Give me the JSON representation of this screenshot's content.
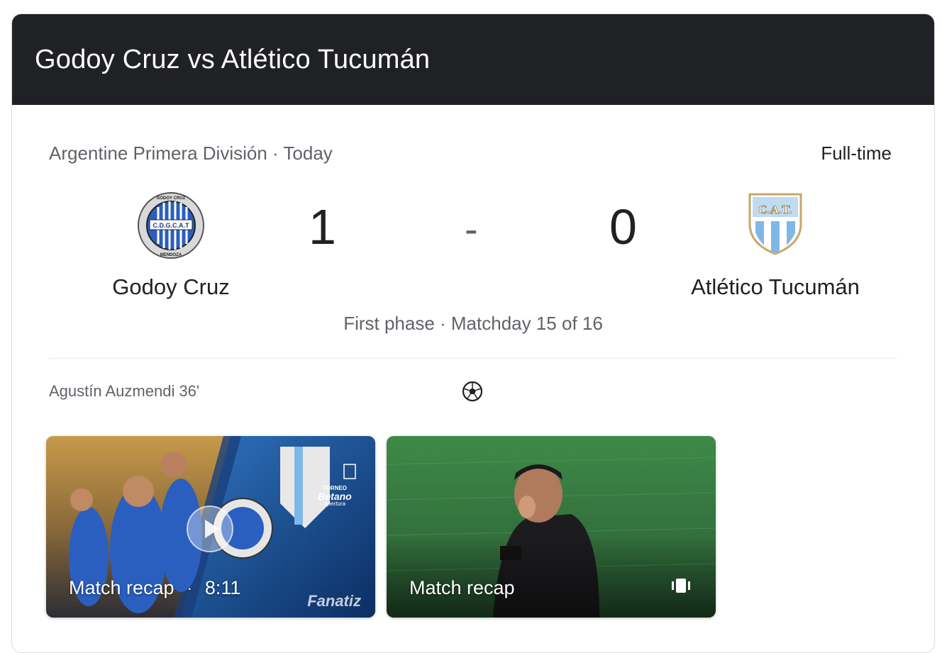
{
  "header": {
    "title": "Godoy Cruz vs Atlético Tucumán"
  },
  "match": {
    "league_date": "Argentine Primera División · Today",
    "status": "Full-time",
    "home": {
      "name": "Godoy Cruz",
      "score": "1",
      "logo_icon": "godoy-cruz-crest-icon",
      "crest_text": "GODOY CRUZ",
      "crest_mid": "C.D.G.C.A.T",
      "crest_bottom": "MENDOZA"
    },
    "away": {
      "name": "Atlético Tucumán",
      "score": "0",
      "logo_icon": "atletico-tucuman-crest-icon",
      "crest_text": "C.A.T."
    },
    "separator": "-",
    "phase": "First phase · Matchday 15 of 16"
  },
  "goals": [
    {
      "scorer": "Agustín Auzmendi 36'",
      "icon": "soccer-ball-icon"
    }
  ],
  "videos": [
    {
      "label": "Match recap",
      "duration": "8:11",
      "separator": "·",
      "brand": "Fanatiz",
      "play_icon": "play-icon",
      "badge_line1": "TORNEO",
      "badge_line2": "Betano",
      "badge_line3": "apertura"
    },
    {
      "label": "Match recap",
      "icon": "shorts-icon"
    }
  ],
  "colors": {
    "header_bg": "#202124",
    "godoy_blue": "#2b5fbf",
    "tucuman_lightblue": "#7fb8e6",
    "pitch_green": "#3f8a4a"
  }
}
